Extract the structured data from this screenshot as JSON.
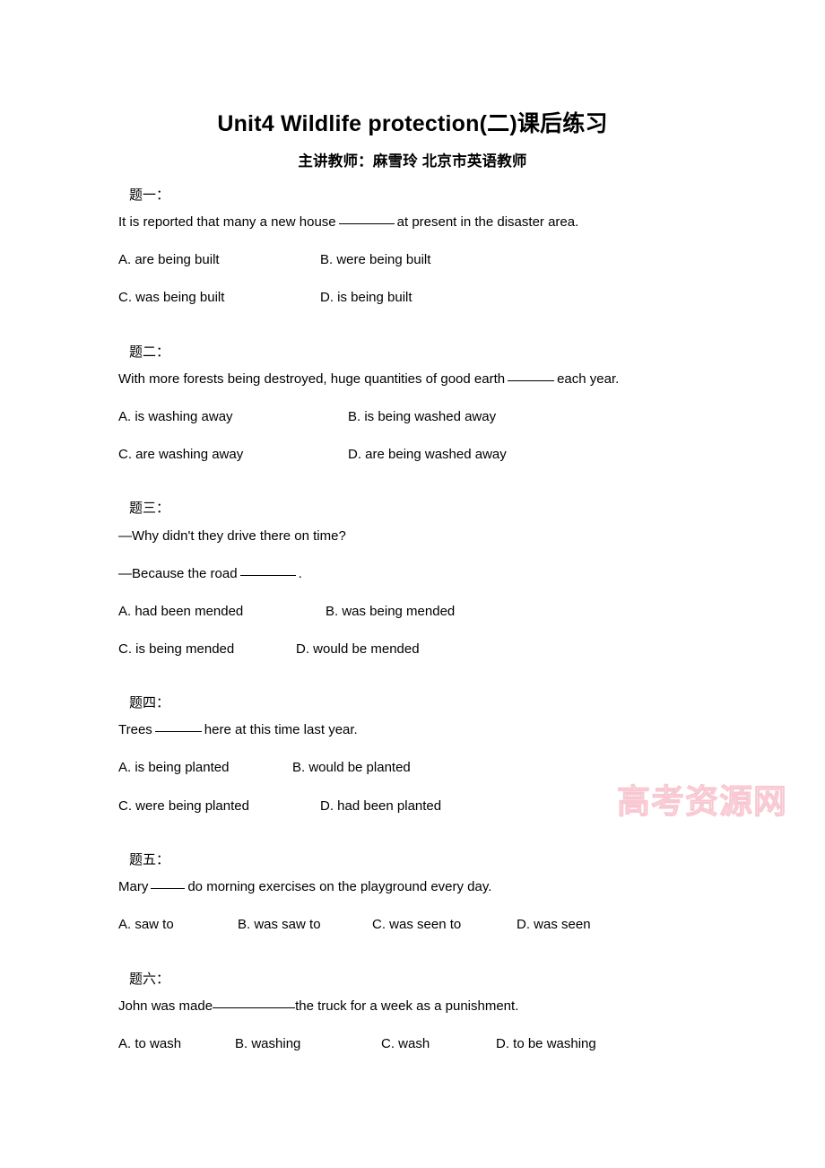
{
  "document": {
    "title": "Unit4 Wildlife protection(二)课后练习",
    "subtitle": "主讲教师：麻雪玲 北京市英语教师",
    "watermark": "高考资源网"
  },
  "questions": [
    {
      "label": "题一：",
      "stem_before": "It is reported that many a new house",
      "stem_after": "at present in the disaster area.",
      "options": [
        {
          "key": "A",
          "text": "A. are being built"
        },
        {
          "key": "B",
          "text": "B. were being built"
        },
        {
          "key": "C",
          "text": "C. was being built"
        },
        {
          "key": "D",
          "text": "D. is being built"
        }
      ]
    },
    {
      "label": "题二：",
      "stem_before": "With more forests being destroyed, huge quantities of good earth",
      "stem_after": "each year.",
      "options": [
        {
          "key": "A",
          "text": "A. is washing away"
        },
        {
          "key": "B",
          "text": "B. is being washed away"
        },
        {
          "key": "C",
          "text": "C. are washing away"
        },
        {
          "key": "D",
          "text": "D. are being washed away"
        }
      ]
    },
    {
      "label": "题三：",
      "stem_line1": "—Why didn't they drive there on time?",
      "stem_before": "—Because the road",
      "stem_after": ".",
      "options": [
        {
          "key": "A",
          "text": "A. had been mended"
        },
        {
          "key": "B",
          "text": "B. was being mended"
        },
        {
          "key": "C",
          "text": "C. is being mended"
        },
        {
          "key": "D",
          "text": "D. would be mended"
        }
      ]
    },
    {
      "label": "题四：",
      "stem_before": "Trees",
      "stem_after": "here at this time last year.",
      "options": [
        {
          "key": "A",
          "text": "A. is being planted"
        },
        {
          "key": "B",
          "text": "B. would be planted"
        },
        {
          "key": "C",
          "text": "C. were being planted"
        },
        {
          "key": "D",
          "text": "D. had been planted"
        }
      ]
    },
    {
      "label": "题五：",
      "stem_before": "Mary",
      "stem_after": "do morning exercises on the playground every day.",
      "options": [
        {
          "key": "A",
          "text": "A. saw to"
        },
        {
          "key": "B",
          "text": "B. was saw to"
        },
        {
          "key": "C",
          "text": "C. was seen to"
        },
        {
          "key": "D",
          "text": "D. was seen"
        }
      ]
    },
    {
      "label": "题六：",
      "stem_before": "John was made",
      "stem_after": "the truck for a week as a punishment.",
      "options": [
        {
          "key": "A",
          "text": "A. to wash"
        },
        {
          "key": "B",
          "text": "B. washing"
        },
        {
          "key": "C",
          "text": "C. wash"
        },
        {
          "key": "D",
          "text": "D. to be washing"
        }
      ]
    }
  ]
}
